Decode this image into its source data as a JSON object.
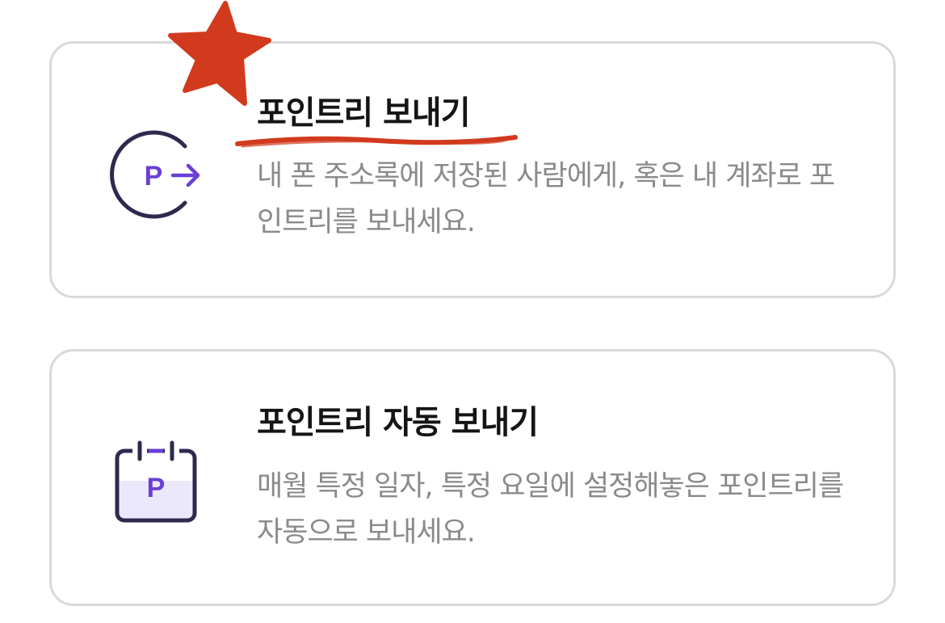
{
  "cards": [
    {
      "title": "포인트리 보내기",
      "description": "내 폰 주소록에 저장된 사람에게, 혹은 내 계좌로 포인트리를 보내세요.",
      "icon_letter": "P",
      "icon": "send-points-arrow-icon"
    },
    {
      "title": "포인트리 자동 보내기",
      "description": "매월 특정 일자, 특정 요일에 설정해놓은 포인트리를 자동으로 보내세요.",
      "icon_letter": "P",
      "icon": "calendar-points-icon"
    }
  ],
  "annotations": {
    "star": "red-star-annotation",
    "underline": "red-underline-annotation"
  },
  "colors": {
    "brand_purple": "#6a3fd6",
    "icon_outline": "#2e2a4e",
    "calendar_band": "#ece8fb",
    "annotation_red": "#d23a1e",
    "title_text": "#151515",
    "description_text": "#8a8a8e",
    "card_border": "#d9d9d9"
  }
}
